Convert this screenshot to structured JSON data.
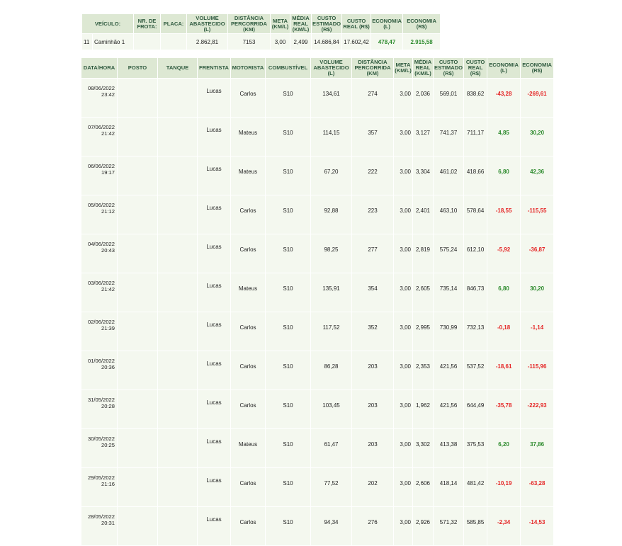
{
  "summary": {
    "headers": [
      "VEÍCULO:",
      "NR. DE FROTA:",
      "PLACA:",
      "VOLUME ABASTECIDO (L)",
      "DISTÂNCIA PERCORRIDA (KM)",
      "META (KM/L)",
      "MÉDIA REAL (KM/L)",
      "CUSTO ESTIMADO (R$)",
      "CUSTO REAL (R$)",
      "ECONOMIA (L)",
      "ECONOMIA (R$)"
    ],
    "row": {
      "vehicle_id": "11",
      "vehicle_name": "Caminhão 1",
      "frota": "",
      "placa": "",
      "volume": "2.862,81",
      "distancia": "7153",
      "meta": "3,00",
      "media": "2,499",
      "custo_estimado": "14.686,84",
      "custo_real": "17.602,42",
      "economia_l": "478,47",
      "economia_rs": "2.915,58"
    }
  },
  "detail": {
    "headers": [
      "DATA/HORA",
      "POSTO",
      "TANQUE",
      "FRENTISTA",
      "MOTORISTA",
      "COMBUSTÍVEL",
      "VOLUME ABASTECIDO (L)",
      "DISTÂNCIA PERCORRIDA (KM)",
      "META (KM/L)",
      "MÉDIA REAL (KM/L)",
      "CUSTO ESTIMADO (R$)",
      "CUSTO REAL (R$)",
      "ECONOMIA (L)",
      "ECONOMIA (R$)"
    ],
    "rows": [
      {
        "date": "08/06/2022",
        "time": "23:42",
        "posto": "",
        "tanque": "",
        "frentista": "Lucas",
        "motorista": "Carlos",
        "combustivel": "S10",
        "volume": "134,61",
        "distancia": "274",
        "meta": "3,00",
        "media": "2,036",
        "custo_est": "569,01",
        "custo_real": "838,62",
        "econ_l": "-43,28",
        "econ_rs": "-269,61",
        "status": "neg"
      },
      {
        "date": "07/06/2022",
        "time": "21:42",
        "posto": "",
        "tanque": "",
        "frentista": "Lucas",
        "motorista": "Mateus",
        "combustivel": "S10",
        "volume": "114,15",
        "distancia": "357",
        "meta": "3,00",
        "media": "3,127",
        "custo_est": "741,37",
        "custo_real": "711,17",
        "econ_l": "4,85",
        "econ_rs": "30,20",
        "status": "pos"
      },
      {
        "date": "06/06/2022",
        "time": "19:17",
        "posto": "",
        "tanque": "",
        "frentista": "Lucas",
        "motorista": "Mateus",
        "combustivel": "S10",
        "volume": "67,20",
        "distancia": "222",
        "meta": "3,00",
        "media": "3,304",
        "custo_est": "461,02",
        "custo_real": "418,66",
        "econ_l": "6,80",
        "econ_rs": "42,36",
        "status": "pos"
      },
      {
        "date": "05/06/2022",
        "time": "21:12",
        "posto": "",
        "tanque": "",
        "frentista": "Lucas",
        "motorista": "Carlos",
        "combustivel": "S10",
        "volume": "92,88",
        "distancia": "223",
        "meta": "3,00",
        "media": "2,401",
        "custo_est": "463,10",
        "custo_real": "578,64",
        "econ_l": "-18,55",
        "econ_rs": "-115,55",
        "status": "neg"
      },
      {
        "date": "04/06/2022",
        "time": "20:43",
        "posto": "",
        "tanque": "",
        "frentista": "Lucas",
        "motorista": "Carlos",
        "combustivel": "S10",
        "volume": "98,25",
        "distancia": "277",
        "meta": "3,00",
        "media": "2,819",
        "custo_est": "575,24",
        "custo_real": "612,10",
        "econ_l": "-5,92",
        "econ_rs": "-36,87",
        "status": "neg"
      },
      {
        "date": "03/06/2022",
        "time": "21:42",
        "posto": "",
        "tanque": "",
        "frentista": "Lucas",
        "motorista": "Mateus",
        "combustivel": "S10",
        "volume": "135,91",
        "distancia": "354",
        "meta": "3,00",
        "media": "2,605",
        "custo_est": "735,14",
        "custo_real": "846,73",
        "econ_l": "6,80",
        "econ_rs": "30,20",
        "status": "pos"
      },
      {
        "date": "02/06/2022",
        "time": "21:39",
        "posto": "",
        "tanque": "",
        "frentista": "Lucas",
        "motorista": "Carlos",
        "combustivel": "S10",
        "volume": "117,52",
        "distancia": "352",
        "meta": "3,00",
        "media": "2,995",
        "custo_est": "730,99",
        "custo_real": "732,13",
        "econ_l": "-0,18",
        "econ_rs": "-1,14",
        "status": "neg"
      },
      {
        "date": "01/06/2022",
        "time": "20:36",
        "posto": "",
        "tanque": "",
        "frentista": "Lucas",
        "motorista": "Carlos",
        "combustivel": "S10",
        "volume": "86,28",
        "distancia": "203",
        "meta": "3,00",
        "media": "2,353",
        "custo_est": "421,56",
        "custo_real": "537,52",
        "econ_l": "-18,61",
        "econ_rs": "-115,96",
        "status": "neg"
      },
      {
        "date": "31/05/2022",
        "time": "20:28",
        "posto": "",
        "tanque": "",
        "frentista": "Lucas",
        "motorista": "Carlos",
        "combustivel": "S10",
        "volume": "103,45",
        "distancia": "203",
        "meta": "3,00",
        "media": "1,962",
        "custo_est": "421,56",
        "custo_real": "644,49",
        "econ_l": "-35,78",
        "econ_rs": "-222,93",
        "status": "neg"
      },
      {
        "date": "30/05/2022",
        "time": "20:25",
        "posto": "",
        "tanque": "",
        "frentista": "Lucas",
        "motorista": "Mateus",
        "combustivel": "S10",
        "volume": "61,47",
        "distancia": "203",
        "meta": "3,00",
        "media": "3,302",
        "custo_est": "413,38",
        "custo_real": "375,53",
        "econ_l": "6,20",
        "econ_rs": "37,86",
        "status": "pos"
      },
      {
        "date": "29/05/2022",
        "time": "21:16",
        "posto": "",
        "tanque": "",
        "frentista": "Lucas",
        "motorista": "Carlos",
        "combustivel": "S10",
        "volume": "77,52",
        "distancia": "202",
        "meta": "3,00",
        "media": "2,606",
        "custo_est": "418,14",
        "custo_real": "481,42",
        "econ_l": "-10,19",
        "econ_rs": "-63,28",
        "status": "neg"
      },
      {
        "date": "28/05/2022",
        "time": "20:31",
        "posto": "",
        "tanque": "",
        "frentista": "Lucas",
        "motorista": "Carlos",
        "combustivel": "S10",
        "volume": "94,34",
        "distancia": "276",
        "meta": "3,00",
        "media": "2,926",
        "custo_est": "571,32",
        "custo_real": "585,85",
        "econ_l": "-2,34",
        "econ_rs": "-14,53",
        "status": "neg"
      }
    ]
  },
  "colors": {
    "header_bg": "#dde8d3",
    "header_text": "#2f5a3f",
    "cell_bg": "#f4f8ef",
    "positive": "#2e8b2e",
    "negative": "#e52626"
  }
}
